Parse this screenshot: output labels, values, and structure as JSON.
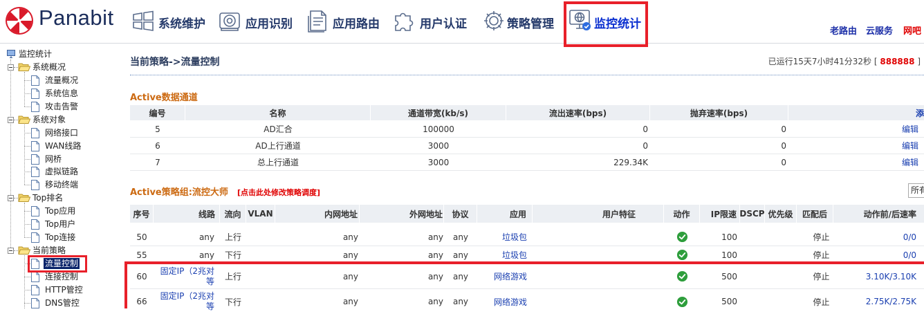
{
  "brand": {
    "name": "Panabit",
    "logo_icon": "umbrella-logo-icon"
  },
  "nav": {
    "items": [
      {
        "label": "系统维护",
        "icon": "windows-tiles-icon"
      },
      {
        "label": "应用识别",
        "icon": "disc-camera-icon"
      },
      {
        "label": "应用路由",
        "icon": "document-route-icon"
      },
      {
        "label": "用户认证",
        "icon": "puzzle-piece-icon"
      },
      {
        "label": "策略管理",
        "icon": "gear-icon"
      },
      {
        "label": "监控统计",
        "icon": "monitor-globe-icon",
        "active": true
      }
    ]
  },
  "header_links": [
    {
      "label": "老路由"
    },
    {
      "label": "云服务"
    },
    {
      "label": "网吧"
    }
  ],
  "sidebar": {
    "root": {
      "label": "监控统计",
      "icon": "monitor-icon"
    },
    "groups": [
      {
        "label": "系统概况",
        "expanded": true,
        "items": [
          "流量概况",
          "系统信息",
          "攻击告警"
        ]
      },
      {
        "label": "系统对象",
        "expanded": true,
        "items": [
          "网络接口",
          "WAN线路",
          "网桥",
          "虚拟链路",
          "移动终端"
        ]
      },
      {
        "label": "Top排名",
        "expanded": true,
        "items": [
          "Top应用",
          "Top用户",
          "Top连接"
        ]
      },
      {
        "label": "当前策略",
        "expanded": true,
        "items": [
          "流量控制",
          "连接控制",
          "HTTP管控",
          "DNS管控"
        ]
      }
    ],
    "selected": "流量控制"
  },
  "main": {
    "page_title": "当前策略->流量控制",
    "uptime": {
      "text": "已运行15天7小时41分32秒",
      "open": "[",
      "serial": "888888",
      "close": "]"
    },
    "channels": {
      "title": "Active数据通道",
      "columns": [
        "编号",
        "名称",
        "通道带宽(kb/s)",
        "流出速率(bps)",
        "抛弃速率(bps)",
        "添"
      ],
      "rows": [
        {
          "id": "5",
          "name": "AD汇合",
          "bandwidth": "100000",
          "out_rate": "0",
          "drop_rate": "0",
          "action": "编辑"
        },
        {
          "id": "6",
          "name": "AD上行通道",
          "bandwidth": "3000",
          "out_rate": "0",
          "drop_rate": "0",
          "action": "编辑"
        },
        {
          "id": "7",
          "name": "总上行通道",
          "bandwidth": "3000",
          "out_rate": "229.34K",
          "drop_rate": "0",
          "action": "编辑"
        }
      ]
    },
    "policy": {
      "title": "Active策略组:流控大师",
      "edit_link": "[点击此处修改策略调度]",
      "filter_select": "所有",
      "columns": [
        "序号",
        "线路",
        "流向",
        "VLAN",
        "内网地址",
        "外网地址",
        "协议",
        "应用",
        "用户特征",
        "动作",
        "IP限速",
        "DSCP",
        "优先级",
        "匹配后",
        "动作前/后速率"
      ],
      "rows": [
        {
          "seq": "50",
          "line": "any",
          "direction": "上行",
          "inner": "any",
          "outer": "any",
          "proto": "any",
          "app": "垃圾包",
          "action_icon": "green-check-icon",
          "ip_limit": "100",
          "after_match": "停止",
          "rate": "0/0"
        },
        {
          "seq": "55",
          "line": "any",
          "direction": "下行",
          "inner": "any",
          "outer": "any",
          "proto": "any",
          "app": "垃圾包",
          "action_icon": "green-check-icon",
          "ip_limit": "100",
          "after_match": "停止",
          "rate": "0/0"
        },
        {
          "seq": "60",
          "line": "固定IP（2兆对等",
          "direction": "上行",
          "inner": "any",
          "outer": "any",
          "proto": "any",
          "app": "网络游戏",
          "action_icon": "green-check-icon",
          "ip_limit": "500",
          "after_match": "停止",
          "rate": "3.10K/3.10K"
        },
        {
          "seq": "66",
          "line": "固定IP（2兆对等",
          "direction": "下行",
          "inner": "any",
          "outer": "any",
          "proto": "any",
          "app": "网络游戏",
          "action_icon": "green-check-icon",
          "ip_limit": "500",
          "after_match": "停止",
          "rate": "2.75K/2.75K"
        }
      ]
    }
  },
  "colors": {
    "brand_navy": "#1b2d5b",
    "nav_active_blue": "#0a2fd0",
    "section_orange": "#cc6a12",
    "link_blue": "#1a3fb0",
    "alert_red": "#e00000",
    "highlight_red": "#e8202a",
    "check_green": "#2e9e3c",
    "selected_bg": "#0a246a"
  }
}
